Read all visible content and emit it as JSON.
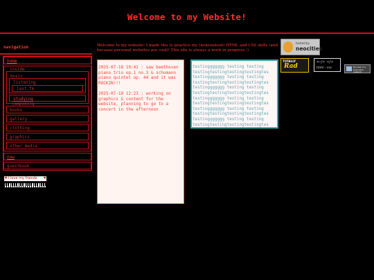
{
  "site": {
    "title": "Welcome to my Website!"
  },
  "nav": {
    "heading": "navigation",
    "home": "home",
    "inside": "inside",
    "music": "music",
    "listening": "listening",
    "last_fm": "last.fm",
    "studying": "studying",
    "composing": "composing",
    "books": "books",
    "gallery": "gallery",
    "clothing": "clothing",
    "graphics": "graphics",
    "other_media": "other media",
    "now": "now",
    "guestbook": "guestbook"
  },
  "badges": {
    "friends": "I love my friends"
  },
  "welcome": "Welcome to my website! I made this to practice my (nonexistent) HTML and CSS skills (and because personal websites are cool)! This site is always a work in progress :)",
  "posts": [
    {
      "text": "2025-07-18 19:41 : saw beethoven piano trio op.1 no.3 & schumann piano quintet op. 44 and it was ROCKIN!!!"
    },
    {
      "text": "2025-07-18 12:23 : working on graphics & content for the website, planning to go to a concert in the afternoon"
    }
  ],
  "testing_lines": [
    "testinggggggg testing testing",
    "testingtestingtestingtestingtes",
    "testinggggggg testing testing",
    "testingtestingtestingtestingtes",
    "testinggggggg testing testing",
    "testingtestingtestingtestingtes",
    "testinggggggg testing testing",
    "testingtestingtestingtestingtes",
    "testinggggggg testing testing",
    "testingtestingtestingtestingtes",
    "testinggggggg testing testing",
    "testingtestingtestingtestingtes"
  ],
  "buttons": {
    "neo_small": "hosted by",
    "neo_big": "neocities",
    "rad_small": "TOTALLY",
    "rad_big": "Rad",
    "html_tag": "<̶/> </>",
    "html_small": "html - css",
    "fed_text": "the web is a federated network"
  }
}
